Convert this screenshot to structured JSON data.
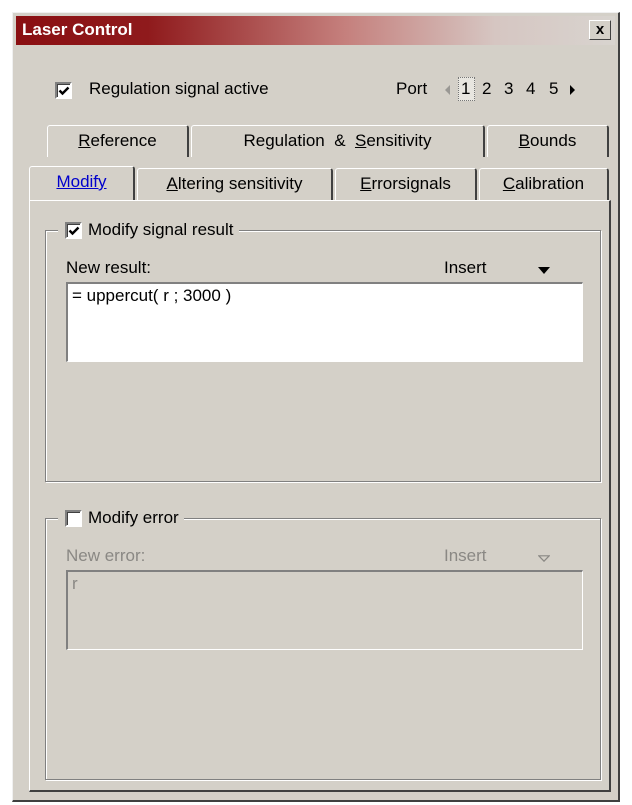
{
  "window": {
    "title": "Laser Control",
    "close_glyph": "x"
  },
  "top": {
    "regulation_label": "Regulation signal active",
    "regulation_checked": true,
    "port_label": "Port",
    "ports": [
      "1",
      "2",
      "3",
      "4",
      "5"
    ],
    "selected_port": "1"
  },
  "tabs_row1": [
    {
      "label": "Reference",
      "underline": "R",
      "rest": "eference"
    },
    {
      "label": "Regulation & Sensitivity",
      "pre": "Regulation  &  ",
      "underline": "S",
      "rest": "ensitivity"
    },
    {
      "label": "Bounds",
      "underline": "B",
      "rest": "ounds"
    }
  ],
  "tabs_row2": [
    {
      "label": "Modify",
      "underline": "M",
      "rest": "odify",
      "active": true
    },
    {
      "label": "Altering sensitivity",
      "underline": "A",
      "rest": "ltering sensitivity"
    },
    {
      "label": "Errorsignals",
      "underline": "E",
      "rest": "rrorsignals"
    },
    {
      "label": "Calibration",
      "underline": "C",
      "rest": "alibration"
    }
  ],
  "modify_result": {
    "checkbox_label": "Modify signal result",
    "checked": true,
    "field_label": "New result:",
    "insert_label": "Insert",
    "value": "= uppercut( r ; 3000 )"
  },
  "modify_error": {
    "checkbox_label": "Modify error",
    "checked": false,
    "field_label": "New error:",
    "insert_label": "Insert",
    "value": "r"
  },
  "icons": {
    "check": "check-icon",
    "close": "close-icon",
    "port_left": "arrow-left-icon",
    "port_right": "arrow-right-icon",
    "dropdown": "dropdown-arrow-icon"
  }
}
